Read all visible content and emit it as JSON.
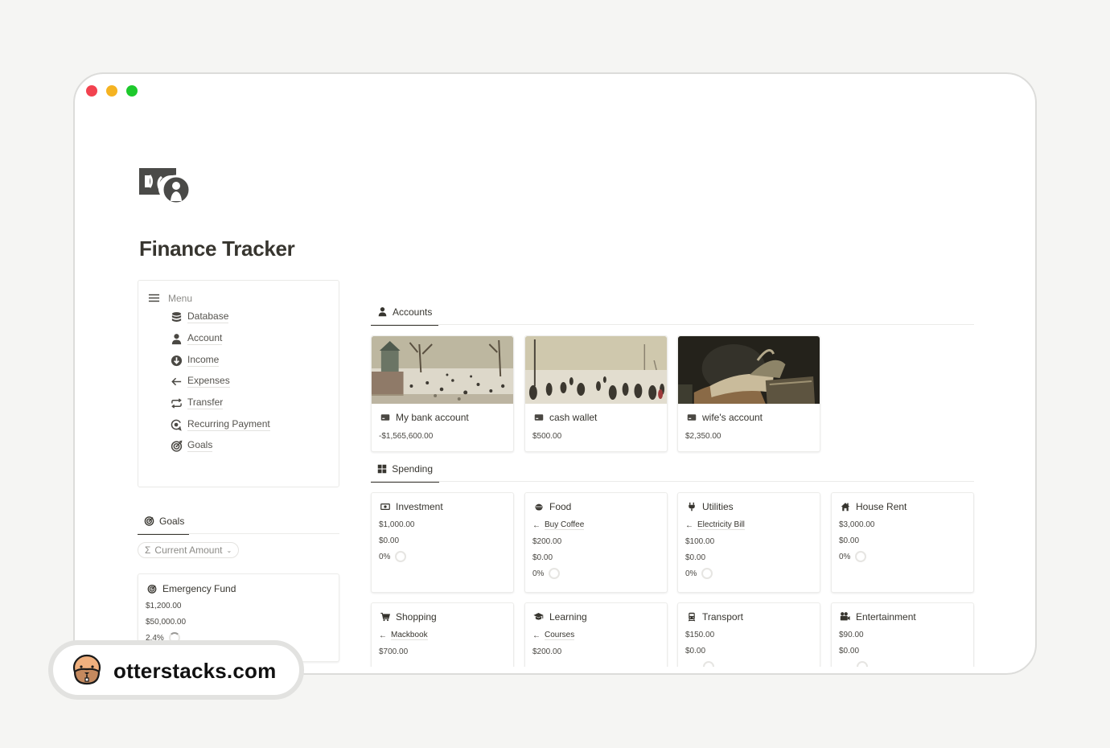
{
  "window": {
    "controls": [
      "close",
      "minimize",
      "maximize"
    ]
  },
  "page": {
    "icon": "money-icon",
    "title": "Finance Tracker"
  },
  "menu": {
    "header": "Menu",
    "items": [
      {
        "label": "Database",
        "icon": "database-icon"
      },
      {
        "label": "Account",
        "icon": "person-icon"
      },
      {
        "label": "Income",
        "icon": "arrow-down-circle-icon"
      },
      {
        "label": "Expenses",
        "icon": "arrow-left-icon"
      },
      {
        "label": "Transfer",
        "icon": "repeat-icon"
      },
      {
        "label": "Recurring Payment",
        "icon": "recurring-icon"
      },
      {
        "label": "Goals",
        "icon": "target-icon"
      }
    ]
  },
  "goals": {
    "tab": "Goals",
    "filter": "Current Amount",
    "cards": [
      {
        "title": "Emergency Fund",
        "current": "$1,200.00",
        "target": "$50,000.00",
        "progress": "2.4%"
      }
    ]
  },
  "accounts": {
    "tab": "Accounts",
    "cards": [
      {
        "title": "My bank account",
        "balance": "-$1,565,600.00",
        "cover": "winter-landscape-painting"
      },
      {
        "title": "cash wallet",
        "balance": "$500.00",
        "cover": "ice-skaters-painting"
      },
      {
        "title": "wife's account",
        "balance": "$2,350.00",
        "cover": "still-life-books-painting"
      }
    ]
  },
  "spending": {
    "tab": "Spending",
    "cards": [
      {
        "title": "Investment",
        "icon": "money-bill-icon",
        "related": null,
        "budget": "$1,000.00",
        "spent": "$0.00",
        "progress": "0%"
      },
      {
        "title": "Food",
        "icon": "bowl-icon",
        "related": "Buy Coffee",
        "budget": "$200.00",
        "spent": "$0.00",
        "progress": "0%"
      },
      {
        "title": "Utilities",
        "icon": "plug-icon",
        "related": "Electricity Bill",
        "budget": "$100.00",
        "spent": "$0.00",
        "progress": "0%"
      },
      {
        "title": "House Rent",
        "icon": "house-icon",
        "related": null,
        "budget": "$3,000.00",
        "spent": "$0.00",
        "progress": "0%"
      },
      {
        "title": "Shopping",
        "icon": "cart-icon",
        "related": "Mackbook",
        "budget": "$700.00",
        "spent": "",
        "progress": ""
      },
      {
        "title": "Learning",
        "icon": "graduation-cap-icon",
        "related": "Courses",
        "budget": "$200.00",
        "spent": "",
        "progress": ""
      },
      {
        "title": "Transport",
        "icon": "train-icon",
        "related": null,
        "budget": "$150.00",
        "spent": "$0.00",
        "progress": ""
      },
      {
        "title": "Entertainment",
        "icon": "video-camera-icon",
        "related": null,
        "budget": "$90.00",
        "spent": "$0.00",
        "progress": ""
      }
    ]
  },
  "banner": {
    "logo": "otter-icon",
    "text": "otterstacks.com"
  }
}
